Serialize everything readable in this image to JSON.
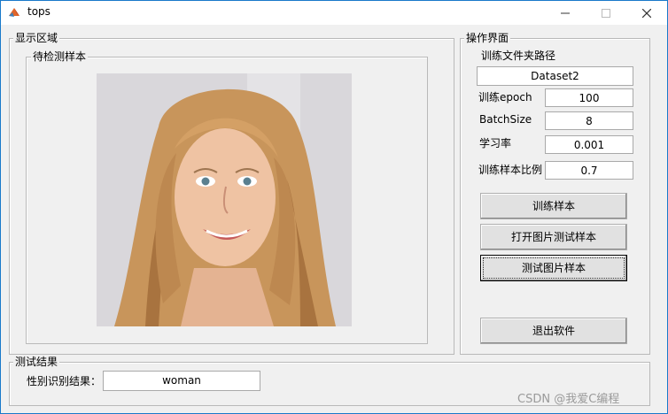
{
  "window": {
    "title": "tops"
  },
  "display_area": {
    "legend": "显示区域",
    "sample_group_legend": "待检测样本"
  },
  "ops_panel": {
    "legend": "操作界面",
    "train_folder_label": "训练文件夹路径",
    "train_folder_value": "Dataset2",
    "epoch_label": "训练epoch",
    "epoch_value": "100",
    "batch_label": "BatchSize",
    "batch_value": "8",
    "lr_label": "学习率",
    "lr_value": "0.001",
    "ratio_label": "训练样本比例",
    "ratio_value": "0.7",
    "train_button": "训练样本",
    "open_image_button": "打开图片测试样本",
    "test_image_button": "测试图片样本",
    "exit_button": "退出软件"
  },
  "result": {
    "legend": "测试结果",
    "gender_label": "性别识别结果：",
    "gender_value": "woman"
  },
  "watermark": "CSDN @我爱C编程"
}
